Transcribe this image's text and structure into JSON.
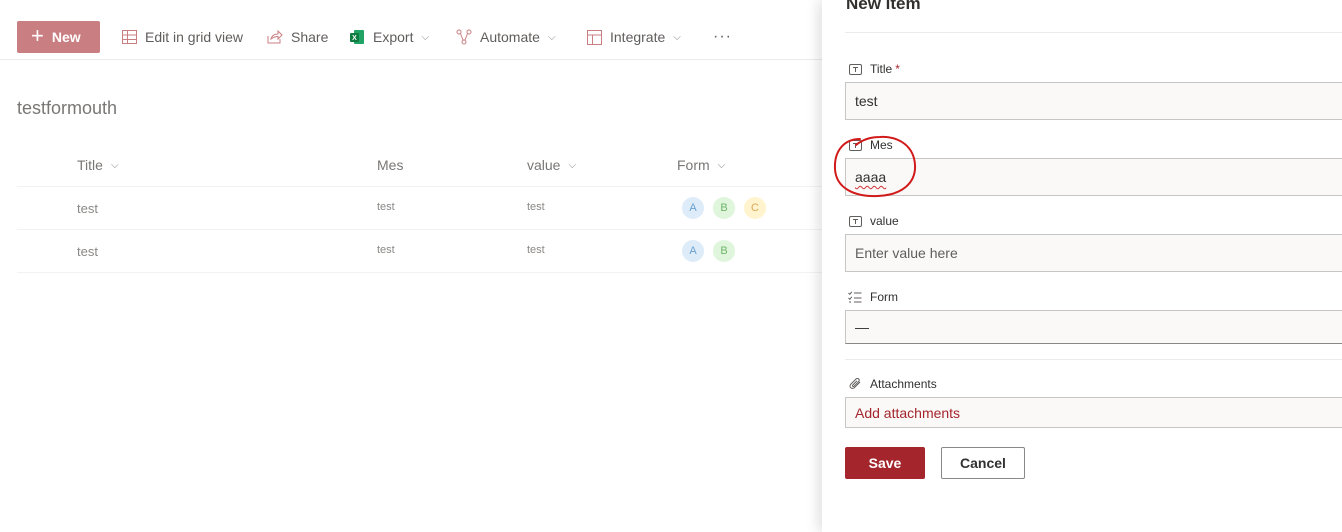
{
  "commandbar": {
    "new_label": "New",
    "edit_grid_label": "Edit in grid view",
    "share_label": "Share",
    "export_label": "Export",
    "automate_label": "Automate",
    "integrate_label": "Integrate",
    "more_label": "···"
  },
  "list": {
    "title": "testformouth",
    "columns": [
      "Title",
      "Mes",
      "value",
      "Form"
    ],
    "rows": [
      {
        "title": "test",
        "mes": "test",
        "value": "test",
        "form": [
          "A",
          "B",
          "C"
        ]
      },
      {
        "title": "test",
        "mes": "test",
        "value": "test",
        "form": [
          "A",
          "B"
        ]
      }
    ]
  },
  "panel": {
    "title": "New item",
    "fields": {
      "title": {
        "label": "Title",
        "required_mark": "*",
        "value": "test"
      },
      "mes": {
        "label": "Mes",
        "value": "aaaa"
      },
      "value": {
        "label": "value",
        "placeholder": "Enter value here"
      },
      "form": {
        "label": "Form",
        "value": "—"
      },
      "attachments": {
        "label": "Attachments",
        "action": "Add attachments"
      }
    },
    "save_label": "Save",
    "cancel_label": "Cancel"
  },
  "colors": {
    "accent": "#a4262c",
    "new_button": "#c97e82",
    "annotation": "#d11a1a"
  }
}
